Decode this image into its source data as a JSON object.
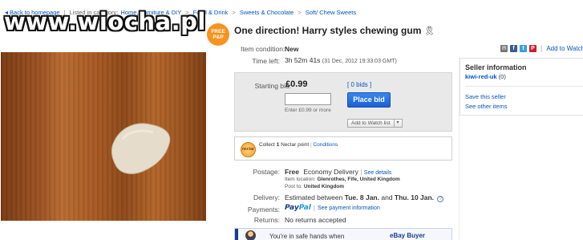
{
  "breadcrumb": {
    "back": "Back to homepage",
    "listed": "Listed in category:",
    "items": [
      "Home, Furniture & DIY",
      "Food & Drink",
      "Sweets & Chocolate",
      "Soft/ Chew Sweets"
    ]
  },
  "watermark": "www.wiocha.pl",
  "badge": {
    "line1": "FREE",
    "line2": "P&P"
  },
  "listing": {
    "title": "One direction! Harry styles chewing gum"
  },
  "share": {
    "icons": [
      "mail-icon",
      "facebook-icon",
      "twitter-icon",
      "pinterest-icon"
    ],
    "watch": "Add to Watch"
  },
  "condition": {
    "label": "Item condition:",
    "value": "New"
  },
  "time_left": {
    "label": "Time left:",
    "value": "3h 52m 41s",
    "date": "(31 Dec, 2012 19:33:03 GMT)"
  },
  "bid": {
    "label": "Starting bid:",
    "price": "£0.99",
    "bids": "[ 0 bids ]",
    "input_value": "",
    "hint": "Enter £0.99 or more",
    "place_bid": "Place bid",
    "watch_list": "Add to Watch list",
    "watch_arrow": "▾"
  },
  "nectar": {
    "logo": "nectar",
    "collect": "Collect",
    "points": "1",
    "text": "Nectar point",
    "conditions": "Conditions"
  },
  "postage": {
    "label": "Postage:",
    "free": "Free",
    "service": "Economy Delivery",
    "see_details": "See details",
    "location_label": "Item location:",
    "location": "Glenrothes, Fife, United Kingdom",
    "post_to_label": "Post to:",
    "post_to": "United Kingdom"
  },
  "delivery": {
    "label": "Delivery:",
    "value_prefix": "Estimated between",
    "from": "Tue. 8 Jan.",
    "and": "and",
    "to": "Thu. 10 Jan."
  },
  "payments": {
    "label": "Payments:",
    "paypal_pay": "Pay",
    "paypal_pal": "Pal",
    "see_payment": "See payment information"
  },
  "returns": {
    "label": "Returns:",
    "value": "No returns accepted"
  },
  "safe": {
    "text": "You're in safe hands when",
    "buyer": "eBay Buyer"
  },
  "seller": {
    "header": "Seller information",
    "name": "kiwi-red-uk",
    "feedback": "(0)",
    "save": "Save this seller",
    "other": "See other items"
  }
}
